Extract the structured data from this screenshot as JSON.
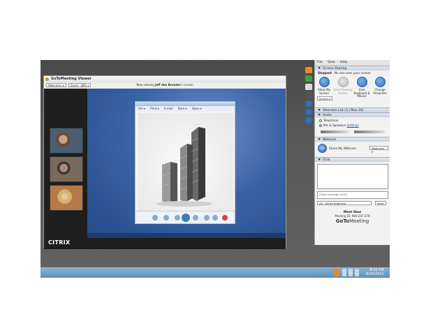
{
  "viewer": {
    "title": "GoToMeeting Viewer",
    "webcams_select": "Webcams ▾",
    "zoom_select": "Zoom: 38% ▾",
    "status_prefix": "Now viewing",
    "status_name": "Jeff den Broeder",
    "status_suffix": "'s screen",
    "brand": "CITRIX"
  },
  "photo_viewer": {
    "menu": [
      "File ▾",
      "Print ▾",
      "E-mail",
      "Burn ▾",
      "Open ▾"
    ]
  },
  "panel": {
    "menu": [
      "File",
      "View",
      "Help"
    ],
    "screen_sharing": {
      "header": "Screen Sharing",
      "status_bold": "Stopped",
      "status_text": "- No one sees your screen",
      "buttons": [
        {
          "label": "Show My Screen",
          "select": "Screen ▾",
          "enabled": true
        },
        {
          "label": "Give Viewing Screen",
          "enabled": false
        },
        {
          "label": "Give Keyboard & Mouse",
          "enabled": true
        },
        {
          "label": "Change Presenter",
          "enabled": true
        }
      ]
    },
    "attendee_list": "Attendee List  (3 | Max 16)",
    "audio": {
      "header": "Audio",
      "telephone": "Telephone",
      "mic": "Mic & Speakers",
      "settings": "Settings"
    },
    "webcam": {
      "header": "Webcam",
      "button": "Off",
      "share": "Share My Webcam",
      "select": "Webcams ▾"
    },
    "chat": {
      "header": "Chat",
      "placeholder": "[Type message here]",
      "audience": "All - Entire Audience",
      "send": "Send"
    },
    "footer": {
      "title": "Meet Now",
      "meeting_id": "Meeting ID: 984-247-378",
      "logo_bold": "GoTo",
      "logo_rest": "Meeting"
    }
  },
  "taskbar": {
    "time": "8:22 PM",
    "date": "6/18/2012"
  },
  "colors": {
    "accent": "#2f6fc0",
    "remote_desktop": "#3b64a8"
  }
}
